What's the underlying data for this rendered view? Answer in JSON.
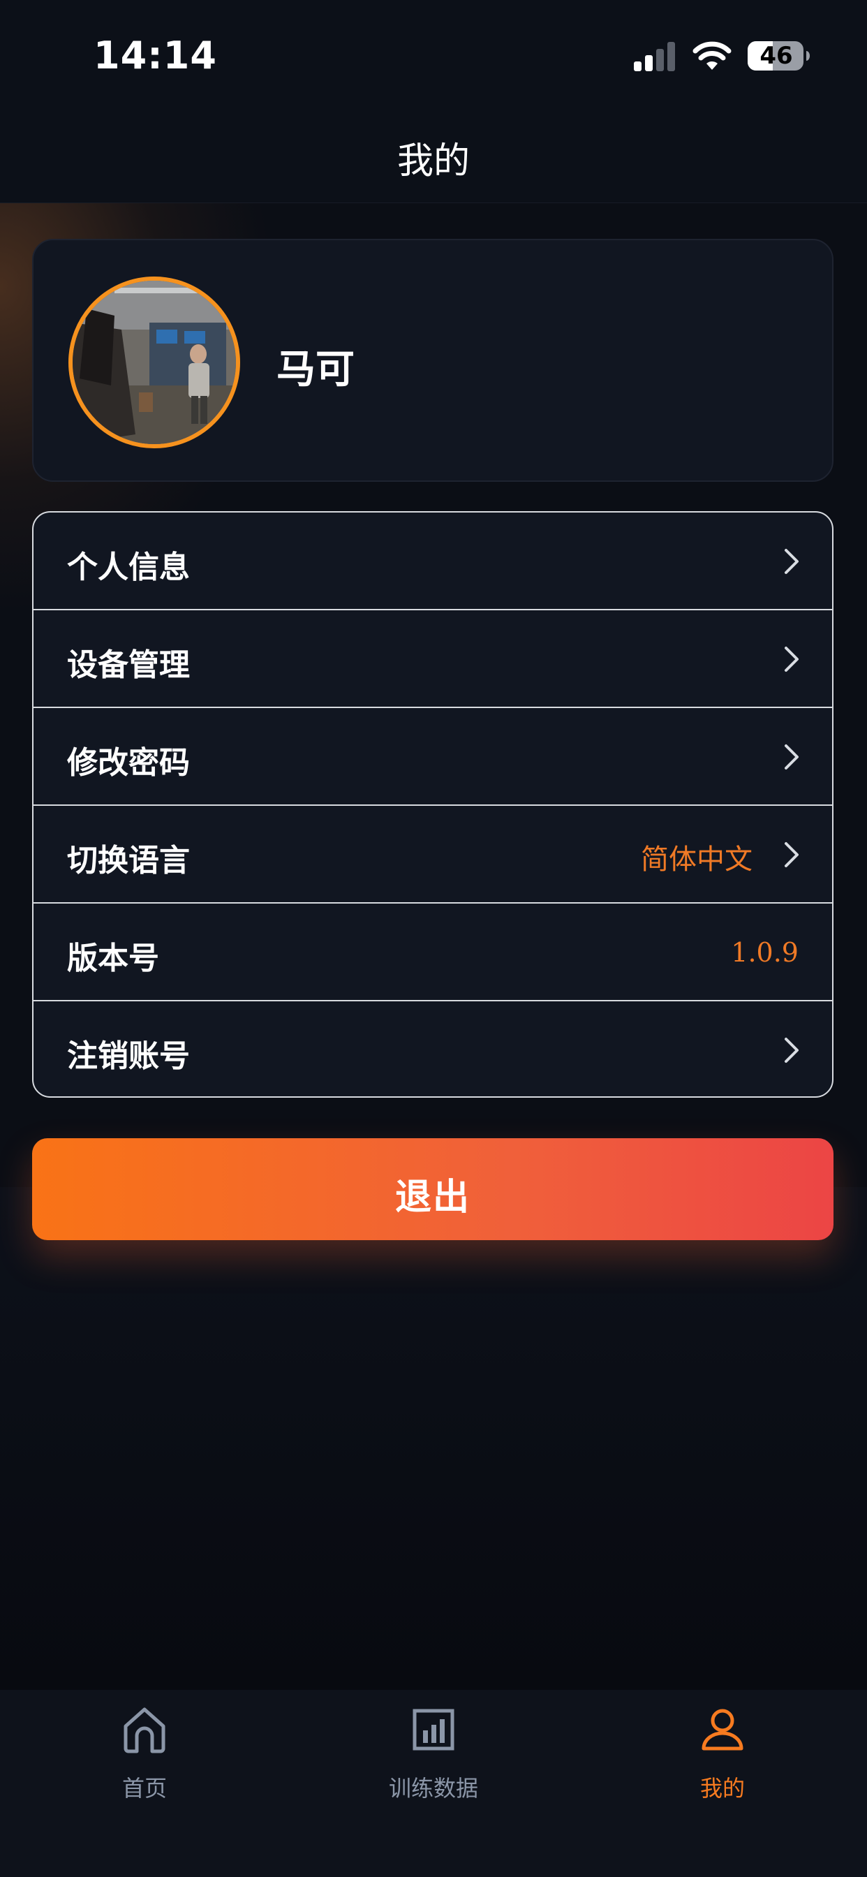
{
  "status_bar": {
    "time": "14:14",
    "battery": "46",
    "icons": [
      "signal-icon",
      "wifi-icon",
      "battery-icon"
    ]
  },
  "header": {
    "title": "我的"
  },
  "profile": {
    "name": "马可",
    "avatar_ring_color": "#f6921e"
  },
  "menu": {
    "items": [
      {
        "label": "个人信息",
        "icon": "chevron-right-icon"
      },
      {
        "label": "设备管理",
        "icon": "chevron-right-icon"
      },
      {
        "label": "修改密码",
        "icon": "chevron-right-icon"
      },
      {
        "label": "切换语言",
        "value": "简体中文",
        "icon": "chevron-right-icon"
      },
      {
        "label": "版本号",
        "value": "1.0.9"
      },
      {
        "label": "注销账号",
        "icon": "chevron-right-icon"
      }
    ]
  },
  "logout": {
    "label": "退出",
    "gradient": [
      "#f97316",
      "#ec4545"
    ]
  },
  "tab_bar": {
    "active_color": "#f77b20",
    "inactive_color": "#8b96a8",
    "tabs": [
      {
        "label": "首页",
        "icon": "home-icon"
      },
      {
        "label": "训练数据",
        "icon": "bar-chart-icon"
      },
      {
        "label": "我的",
        "icon": "user-icon",
        "active": true
      }
    ]
  },
  "colors": {
    "background": "#0b0e15",
    "card": "#111621",
    "accent": "#f07a26"
  }
}
